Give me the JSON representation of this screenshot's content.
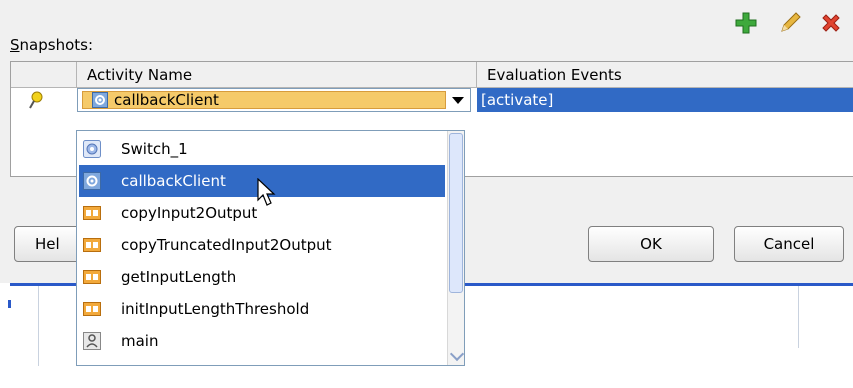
{
  "dialog": {
    "snapshots_label_prefix": "S",
    "snapshots_label_rest": "napshots:",
    "toolbar": {
      "add_icon": "plus-icon",
      "edit_icon": "pencil-icon",
      "delete_icon": "x-icon"
    }
  },
  "table": {
    "columns": [
      "Activity Name",
      "Evaluation Events"
    ],
    "row": {
      "marker_icon": "pin-icon",
      "activity_name": "callbackClient",
      "evaluation_events": "[activate]"
    }
  },
  "dropdown": {
    "items": [
      {
        "label": "Switch_1",
        "icon": "switch-icon",
        "selected": false
      },
      {
        "label": "callbackClient",
        "icon": "gear-icon",
        "selected": true
      },
      {
        "label": "copyInput2Output",
        "icon": "assign-icon",
        "selected": false
      },
      {
        "label": "copyTruncatedInput2Output",
        "icon": "assign-icon",
        "selected": false
      },
      {
        "label": "getInputLength",
        "icon": "assign-icon",
        "selected": false
      },
      {
        "label": "initInputLengthThreshold",
        "icon": "assign-icon",
        "selected": false
      },
      {
        "label": "main",
        "icon": "scope-icon",
        "selected": false
      }
    ]
  },
  "buttons": {
    "help": "Hel",
    "ok": "OK",
    "cancel": "Cancel"
  },
  "colors": {
    "selection": "#316ac5",
    "accent_line": "#2a59c8"
  }
}
